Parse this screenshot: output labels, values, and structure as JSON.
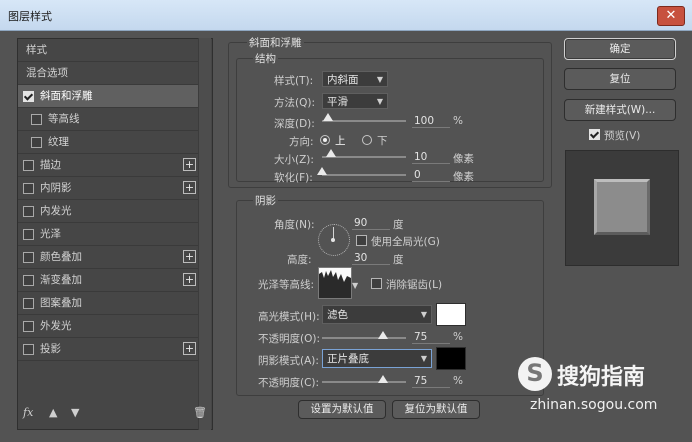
{
  "window": {
    "title": "图层样式",
    "close_glyph": "✕"
  },
  "sidebar": {
    "header": "样式",
    "blend_options": "混合选项",
    "items": [
      {
        "label": "斜面和浮雕",
        "checked": true,
        "selected": true,
        "plus": false
      },
      {
        "label": "等高线",
        "checked": false,
        "sub": true,
        "plus": false
      },
      {
        "label": "纹理",
        "checked": false,
        "sub": true,
        "plus": false
      },
      {
        "label": "描边",
        "checked": false,
        "plus": true
      },
      {
        "label": "内阴影",
        "checked": false,
        "plus": true
      },
      {
        "label": "内发光",
        "checked": false,
        "plus": false
      },
      {
        "label": "光泽",
        "checked": false,
        "plus": false
      },
      {
        "label": "颜色叠加",
        "checked": false,
        "plus": true
      },
      {
        "label": "渐变叠加",
        "checked": false,
        "plus": true
      },
      {
        "label": "图案叠加",
        "checked": false,
        "plus": false
      },
      {
        "label": "外发光",
        "checked": false,
        "plus": false
      },
      {
        "label": "投影",
        "checked": false,
        "plus": true
      }
    ],
    "fx_label": "fx",
    "plus_glyph": "+"
  },
  "bevel": {
    "section_title": "斜面和浮雕",
    "structure_title": "结构",
    "style_label": "样式(T):",
    "style_value": "内斜面",
    "technique_label": "方法(Q):",
    "technique_value": "平滑",
    "depth_label": "深度(D):",
    "depth_value": "100",
    "depth_unit": "%",
    "direction_label": "方向:",
    "dir_up": "上",
    "dir_down": "下",
    "size_label": "大小(Z):",
    "size_value": "10",
    "size_unit": "像素",
    "soften_label": "软化(F):",
    "soften_value": "0",
    "soften_unit": "像素"
  },
  "shading": {
    "title": "阴影",
    "angle_label": "角度(N):",
    "angle_value": "90",
    "angle_unit": "度",
    "global_light_label": "使用全局光(G)",
    "altitude_label": "高度:",
    "altitude_value": "30",
    "altitude_unit": "度",
    "gloss_contour_label": "光泽等高线:",
    "antialias_label": "消除锯齿(L)",
    "highlight_mode_label": "高光模式(H):",
    "highlight_mode_value": "滤色",
    "highlight_color": "#ffffff",
    "highlight_opacity_label": "不透明度(O):",
    "highlight_opacity_value": "75",
    "opacity_unit": "%",
    "shadow_mode_label": "阴影模式(A):",
    "shadow_mode_value": "正片叠底",
    "shadow_color": "#000000",
    "shadow_opacity_label": "不透明度(C):",
    "shadow_opacity_value": "75"
  },
  "footer": {
    "set_default": "设置为默认值",
    "reset_default": "复位为默认值"
  },
  "actions": {
    "ok": "确定",
    "reset": "复位",
    "new_style": "新建样式(W)...",
    "preview_label": "预览(V)"
  },
  "watermark": {
    "badge": "S",
    "brand": "搜狗指南",
    "url": "zhinan.sogou.com"
  }
}
